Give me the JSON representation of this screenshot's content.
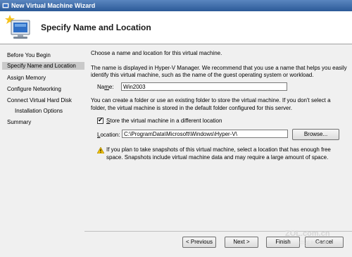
{
  "window": {
    "title": "New Virtual Machine Wizard"
  },
  "header": {
    "title": "Specify Name and Location"
  },
  "sidebar": {
    "items": [
      {
        "label": "Before You Begin"
      },
      {
        "label": "Specify Name and Location"
      },
      {
        "label": "Assign Memory"
      },
      {
        "label": "Configure Networking"
      },
      {
        "label": "Connect Virtual Hard Disk"
      },
      {
        "label": "Installation Options"
      },
      {
        "label": "Summary"
      }
    ],
    "selected": "Specify Name and Location"
  },
  "content": {
    "intro": "Choose a name and location for this virtual machine.",
    "desc_line1": "The name is displayed in Hyper-V Manager. We recommend that you use a name that helps you easily",
    "desc_line2": "identify this virtual machine, such as the name of the guest operating system or workload.",
    "name_label_accel": "m",
    "name_label_a": "Na",
    "name_label_b": "e:",
    "name_value": "Win2003",
    "folder_line1": "You can create a folder or use an existing folder to store the virtual machine. If you don't select a",
    "folder_line2": "folder, the virtual machine is stored in the default folder configured for this server.",
    "store_checkbox_accel": "S",
    "store_checkbox_rest": "tore the virtual machine in a different location",
    "store_checked": true,
    "location_label_accel": "L",
    "location_label_rest": "ocation:",
    "location_value": "C:\\ProgramData\\Microsoft\\Windows\\Hyper-V\\",
    "browse_label": "Browse...",
    "warning_line1": "If you plan to take snapshots of this virtual machine, select a location that has enough free",
    "warning_line2": "space. Snapshots include virtual machine data and may require a large amount of space."
  },
  "footer": {
    "previous_label": "< Previous",
    "next_label": "Next >",
    "finish_label": "Finish",
    "cancel_label": "Cancel"
  },
  "watermark": {
    "text": "ZOL.com.cn",
    "subtext": "中关村在线"
  },
  "colors": {
    "titlebar": "#2c5a98",
    "selected_nav": "#c9c9c9",
    "warning": "#f2c200"
  }
}
